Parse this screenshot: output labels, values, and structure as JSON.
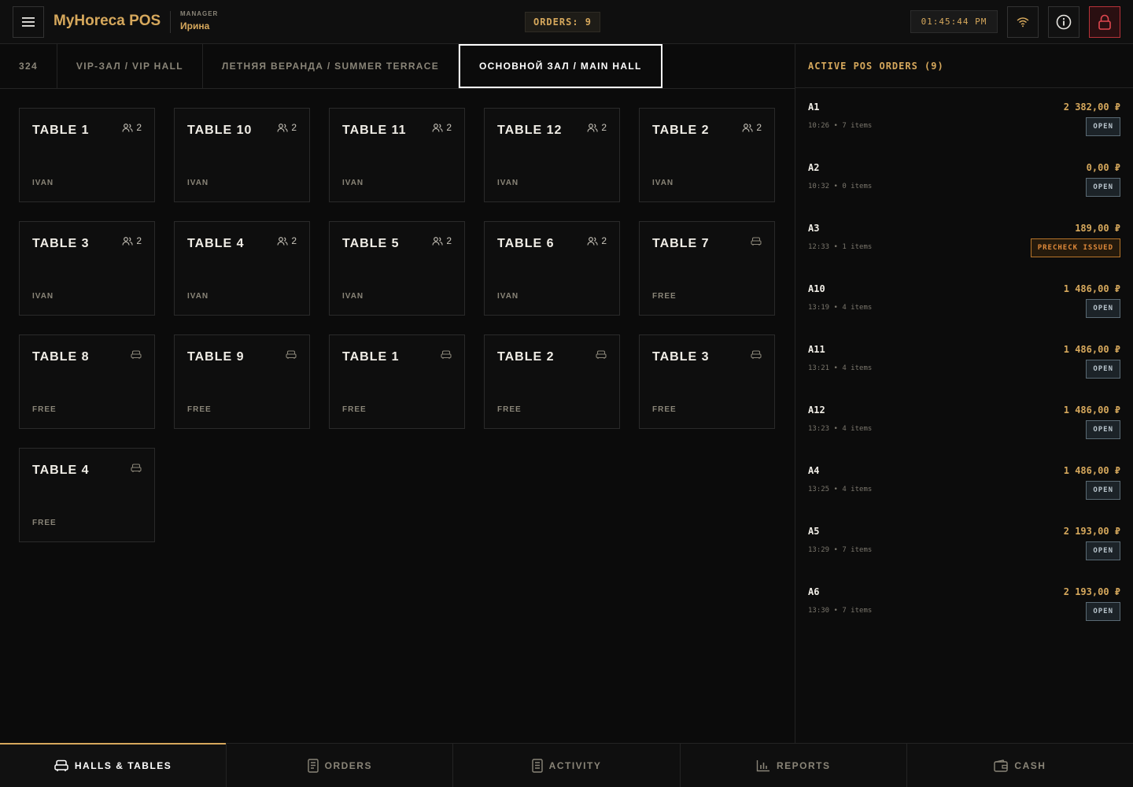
{
  "header": {
    "brand": "MyHoreca POS",
    "role": "MANAGER",
    "user": "Ирина",
    "orders_label": "ORDERS: 9",
    "clock": "01:45:44 PM"
  },
  "tabs": [
    {
      "label": "324",
      "active": false
    },
    {
      "label": "VIP-ЗАЛ / VIP HALL",
      "active": false
    },
    {
      "label": "ЛЕТНЯЯ ВЕРАНДА / SUMMER TERRACE",
      "active": false
    },
    {
      "label": "ОСНОВНОЙ ЗАЛ / MAIN HALL",
      "active": true
    }
  ],
  "tables": [
    {
      "name": "TABLE 1",
      "guests": "2",
      "status": "IVAN",
      "free": false
    },
    {
      "name": "TABLE 10",
      "guests": "2",
      "status": "IVAN",
      "free": false
    },
    {
      "name": "TABLE 11",
      "guests": "2",
      "status": "IVAN",
      "free": false
    },
    {
      "name": "TABLE 12",
      "guests": "2",
      "status": "IVAN",
      "free": false
    },
    {
      "name": "TABLE 2",
      "guests": "2",
      "status": "IVAN",
      "free": false
    },
    {
      "name": "TABLE 3",
      "guests": "2",
      "status": "IVAN",
      "free": false
    },
    {
      "name": "TABLE 4",
      "guests": "2",
      "status": "IVAN",
      "free": false
    },
    {
      "name": "TABLE 5",
      "guests": "2",
      "status": "IVAN",
      "free": false
    },
    {
      "name": "TABLE 6",
      "guests": "2",
      "status": "IVAN",
      "free": false
    },
    {
      "name": "TABLE 7",
      "guests": "",
      "status": "FREE",
      "free": true
    },
    {
      "name": "TABLE 8",
      "guests": "",
      "status": "FREE",
      "free": true
    },
    {
      "name": "TABLE 9",
      "guests": "",
      "status": "FREE",
      "free": true
    },
    {
      "name": "TABLE 1",
      "guests": "",
      "status": "FREE",
      "free": true
    },
    {
      "name": "TABLE 2",
      "guests": "",
      "status": "FREE",
      "free": true
    },
    {
      "name": "TABLE 3",
      "guests": "",
      "status": "FREE",
      "free": true
    },
    {
      "name": "TABLE 4",
      "guests": "",
      "status": "FREE",
      "free": true
    }
  ],
  "side_panel": {
    "title": "ACTIVE POS ORDERS (9)",
    "orders": [
      {
        "id": "A1",
        "meta": "10:26 • 7 items",
        "amount": "2 382,00 ₽",
        "badge": "OPEN",
        "precheck": false
      },
      {
        "id": "A2",
        "meta": "10:32 • 0 items",
        "amount": "0,00 ₽",
        "badge": "OPEN",
        "precheck": false
      },
      {
        "id": "A3",
        "meta": "12:33 • 1 items",
        "amount": "189,00 ₽",
        "badge": "PRECHECK ISSUED",
        "precheck": true
      },
      {
        "id": "A10",
        "meta": "13:19 • 4 items",
        "amount": "1 486,00 ₽",
        "badge": "OPEN",
        "precheck": false
      },
      {
        "id": "A11",
        "meta": "13:21 • 4 items",
        "amount": "1 486,00 ₽",
        "badge": "OPEN",
        "precheck": false
      },
      {
        "id": "A12",
        "meta": "13:23 • 4 items",
        "amount": "1 486,00 ₽",
        "badge": "OPEN",
        "precheck": false
      },
      {
        "id": "A4",
        "meta": "13:25 • 4 items",
        "amount": "1 486,00 ₽",
        "badge": "OPEN",
        "precheck": false
      },
      {
        "id": "A5",
        "meta": "13:29 • 7 items",
        "amount": "2 193,00 ₽",
        "badge": "OPEN",
        "precheck": false
      },
      {
        "id": "A6",
        "meta": "13:30 • 7 items",
        "amount": "2 193,00 ₽",
        "badge": "OPEN",
        "precheck": false
      }
    ]
  },
  "bottom_nav": [
    {
      "label": "HALLS & TABLES",
      "icon": "sofa-icon",
      "active": true
    },
    {
      "label": "ORDERS",
      "icon": "receipt-icon",
      "active": false
    },
    {
      "label": "ACTIVITY",
      "icon": "document-icon",
      "active": false
    },
    {
      "label": "REPORTS",
      "icon": "bar-chart-icon",
      "active": false
    },
    {
      "label": "CASH",
      "icon": "wallet-icon",
      "active": false
    }
  ],
  "colors": {
    "accent": "#d6a85c",
    "background": "#0b0b0b",
    "lock": "#b8333a",
    "precheck": "#e08a3a"
  }
}
